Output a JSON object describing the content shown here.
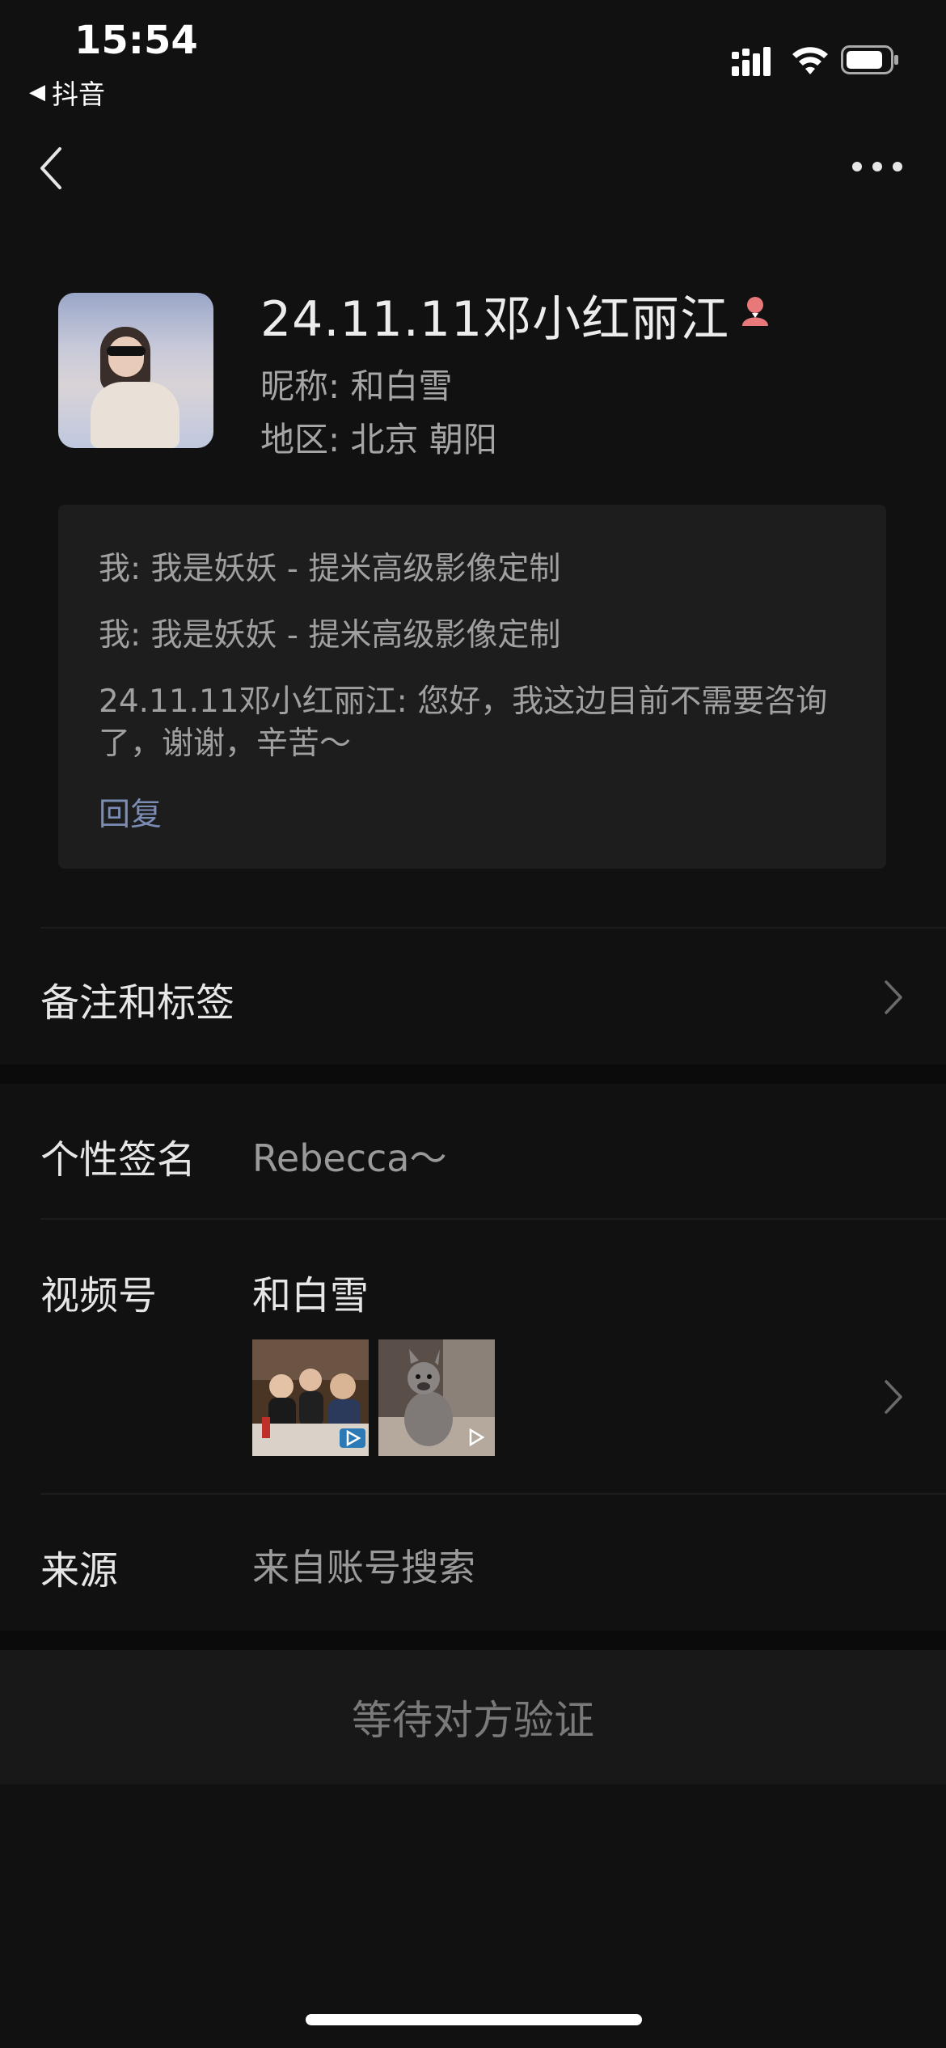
{
  "status_bar": {
    "time": "15:54",
    "back_app_label": "抖音",
    "icons": [
      "cellular-signal-icon",
      "wifi-icon",
      "battery-icon"
    ]
  },
  "nav": {
    "icons": [
      "back-chevron-icon",
      "more-dots-icon"
    ]
  },
  "profile": {
    "name": "24.11.11邓小红丽江",
    "gender_icon": "female-icon",
    "nickname": "昵称: 和白雪",
    "region": "地区: 北京 朝阳"
  },
  "messages": {
    "items": [
      "我: 我是妖妖 - 提米高级影像定制",
      "我: 我是妖妖 - 提米高级影像定制",
      "24.11.11邓小红丽江: 您好，我这边目前不需要咨询了，谢谢，辛苦～"
    ],
    "reply_label": "回复"
  },
  "rows": {
    "remarks_label": "备注和标签",
    "signature_label": "个性签名",
    "signature_value": "Rebecca～",
    "channels_label": "视频号",
    "channels_value": "和白雪",
    "source_label": "来源",
    "source_value": "来自账号搜索"
  },
  "action": {
    "pending_label": "等待对方验证"
  },
  "colors": {
    "background": "#111111",
    "panel": "#1d1d1d",
    "link": "#7b8db5",
    "female_icon": "#e8787a"
  }
}
